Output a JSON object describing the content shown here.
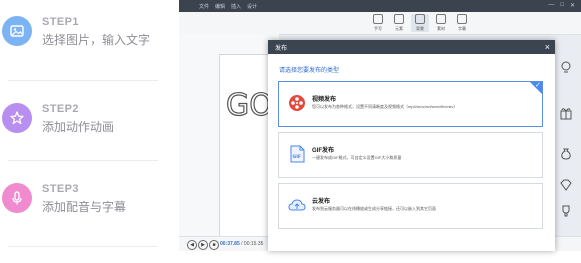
{
  "steps": [
    {
      "title": "STEP1",
      "desc": "选择图片，输入文字",
      "icon": "image-icon",
      "color": "#7bb3f5"
    },
    {
      "title": "STEP2",
      "desc": "添加动作动画",
      "icon": "sparkle-star-icon",
      "color": "#b88ef0"
    },
    {
      "title": "STEP3",
      "desc": "添加配音与字幕",
      "icon": "microphone-icon",
      "color": "#f08bd0"
    }
  ],
  "app": {
    "menu": [
      "文件",
      "编辑",
      "插入",
      "设计"
    ],
    "toolbar": [
      "手写",
      "元素",
      "背景",
      "素材",
      "字幕"
    ],
    "playback": {
      "current": "00:37.85",
      "total": "00:15.35"
    },
    "canvas_text": "GO"
  },
  "dialog": {
    "title": "发布",
    "close": "×",
    "prompt": "请选择您要发布的类型",
    "options": [
      {
        "name": "视频发布",
        "desc": "您可以发布为各种格式，设置不同清晰度及视频格式（mp4/mov/avi/wmv/flv/mkv）",
        "icon": "video-reel-icon",
        "color": "#e04a3f",
        "selected": true
      },
      {
        "name": "GIF发布",
        "desc": "一键发布成GIF格式，可自定义设置GIF大小和质量",
        "icon": "gif-file-icon",
        "color": "#4a86e8",
        "selected": false
      },
      {
        "name": "云发布",
        "desc": "发布到云服务器可以在线播放或生成分享链接，还可以嵌入到其它页面",
        "icon": "cloud-upload-icon",
        "color": "#4a86e8",
        "selected": false
      }
    ]
  },
  "colors": {
    "accent": "#2f6bd2",
    "dialog_header": "#3b4451",
    "title_bar": "#3b434f"
  }
}
